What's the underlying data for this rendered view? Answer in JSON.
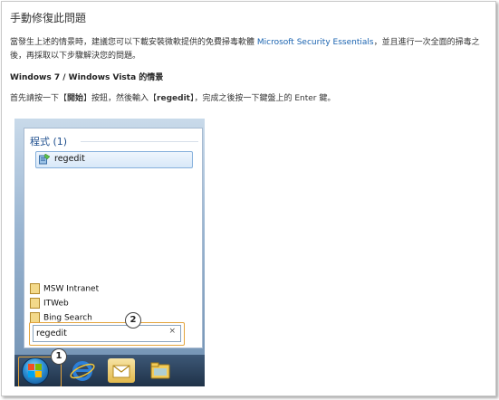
{
  "page": {
    "title": "手動修復此問題",
    "intro_before_link": "當發生上述的情景時，建議您可以下載安裝微軟提供的免費掃毒軟體 ",
    "intro_link": "Microsoft Security Essentials",
    "intro_after_link": "，並且進行一次全面的掃毒之後，再採取以下步驟解決您的問題。",
    "section_heading": "Windows 7 / Windows Vista 的情景",
    "step_before_1": "首先請按一下【",
    "step_kw_1": "開始",
    "step_middle": "】按鈕，然後輸入【",
    "step_kw_2": "regedit",
    "step_after": "】，完成之後按一下鍵盤上的 Enter 鍵。"
  },
  "start_menu": {
    "section_title": "程式 (1)",
    "result_label": "regedit",
    "links": [
      {
        "label": "MSW Intranet"
      },
      {
        "label": "ITWeb"
      },
      {
        "label": "Bing Search"
      }
    ],
    "search_value": "regedit",
    "clear_glyph": "×",
    "callout_1": "1",
    "callout_2": "2"
  },
  "icons": {
    "start": "windows-orb-icon",
    "ie": "internet-explorer-icon",
    "outlook": "outlook-icon",
    "explorer": "folder-explorer-icon",
    "regedit": "registry-editor-icon",
    "link": "bookmark-link-icon"
  },
  "colors": {
    "link": "#1a63b0",
    "highlight": "#e3a33c",
    "menu_title": "#1f4f8e"
  }
}
